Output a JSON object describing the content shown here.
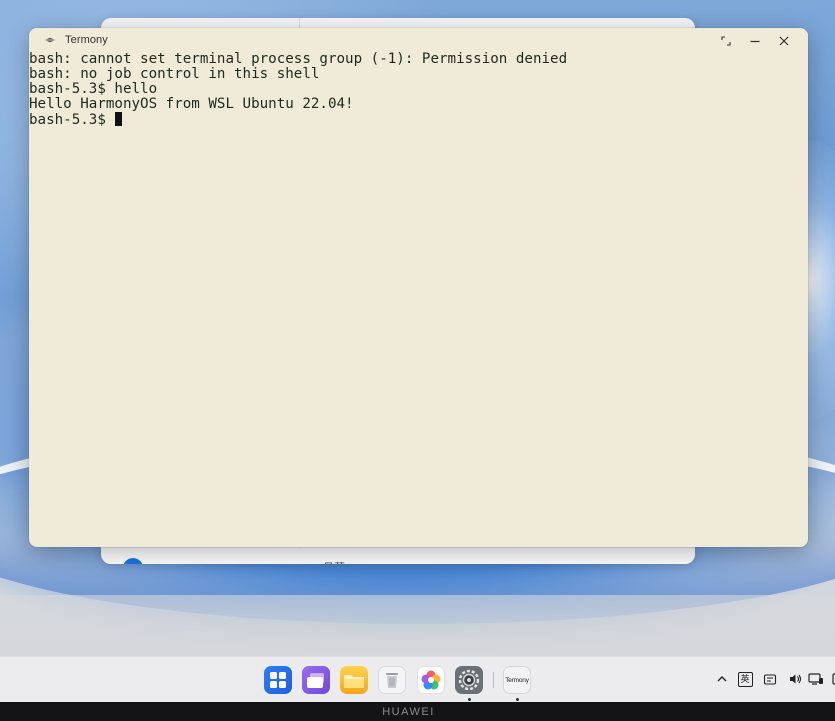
{
  "desktop": {
    "background_window": {
      "faint_text": "日草"
    }
  },
  "terminal": {
    "title": "Termony",
    "lines": [
      "bash: cannot set terminal process group (-1): Permission denied",
      "bash: no job control in this shell",
      "bash-5.3$ hello",
      "Hello HarmonyOS from WSL Ubuntu 22.04!"
    ],
    "prompt": "bash-5.3$ ",
    "background_color": "#f0ead8",
    "text_color": "#1e2a1e"
  },
  "window_controls": {
    "restore_icon": "restore-icon",
    "minimize_icon": "minimize-icon",
    "close_icon": "close-icon"
  },
  "dock": {
    "apps": [
      {
        "name": "launcher",
        "icon": "app-grid-icon"
      },
      {
        "name": "multitask",
        "icon": "multitask-icon"
      },
      {
        "name": "files",
        "icon": "folder-icon"
      },
      {
        "name": "trash",
        "icon": "trash-icon"
      },
      {
        "name": "gallery",
        "icon": "gallery-icon"
      },
      {
        "name": "settings",
        "icon": "settings-icon",
        "running": true
      },
      {
        "name": "termony",
        "icon": "termony-icon",
        "running": true
      }
    ],
    "termony_label": "Termony"
  },
  "system_tray": {
    "ime_label": "英",
    "icons": [
      "chevron-up-icon",
      "ime-icon",
      "keyboard-icon",
      "volume-icon",
      "display-icon",
      "more-icon"
    ]
  },
  "brand": {
    "text": "HUAWEI"
  }
}
